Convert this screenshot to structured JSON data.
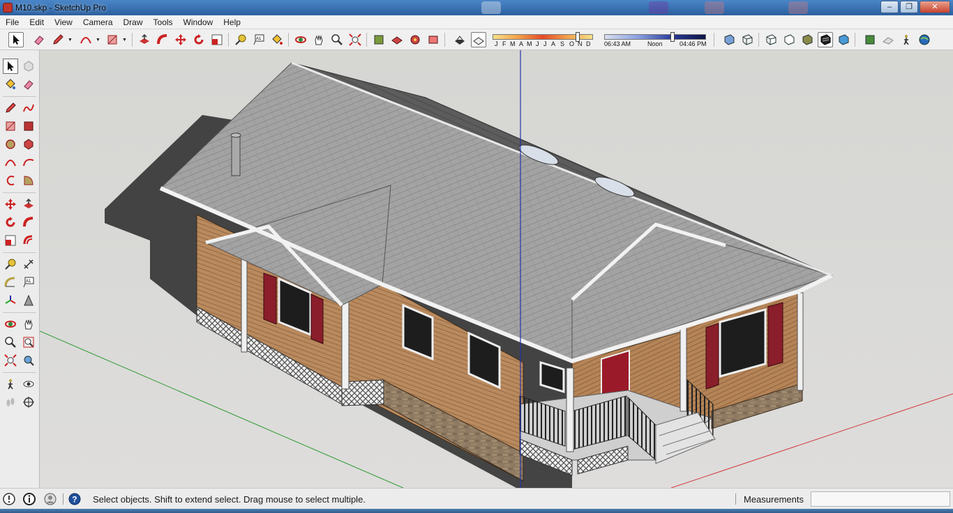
{
  "window": {
    "title": "M10.skp - SketchUp Pro",
    "controls": {
      "minimize": "–",
      "restore": "❐",
      "close": "✕"
    }
  },
  "menu": [
    "File",
    "Edit",
    "View",
    "Camera",
    "Draw",
    "Tools",
    "Window",
    "Help"
  ],
  "toolbar": {
    "tools": [
      "select-icon",
      "eraser-icon",
      "pencil-icon",
      "arc-icon",
      "rectangle-icon",
      "push-pull-icon",
      "follow-me-icon",
      "move-icon",
      "rotate-icon",
      "scale-icon",
      "tape-measure-icon",
      "text-icon",
      "paint-bucket-icon",
      "orbit-icon",
      "pan-icon",
      "zoom-icon",
      "zoom-extents-icon",
      "warehouse-icon",
      "share-model-icon",
      "components-icon",
      "extension-icon",
      "display-shadows-icon",
      "display-fog-icon",
      "xray-icon",
      "wireframe-icon",
      "hidden-line-icon",
      "shaded-icon",
      "shaded-textures-icon",
      "monochrome-icon",
      "geo-location-icon",
      "sandbox-icon",
      "walk-icon",
      "google-earth-icon"
    ],
    "shadow_months": [
      "J",
      "F",
      "M",
      "A",
      "M",
      "J",
      "J",
      "A",
      "S",
      "O",
      "N",
      "D"
    ],
    "shadow_times": {
      "start": "06:43 AM",
      "middle": "Noon",
      "end": "04:46 PM"
    }
  },
  "palette": {
    "tools": [
      "select-icon",
      "component-icon",
      "paint-bucket-icon",
      "eraser-icon",
      "line-icon",
      "freehand-icon",
      "rectangle-icon",
      "rotated-rectangle-icon",
      "circle-icon",
      "polygon-icon",
      "arc-icon",
      "two-point-arc-icon",
      "three-point-arc-icon",
      "pie-icon",
      "move-icon",
      "push-pull-icon",
      "rotate-icon",
      "follow-me-icon",
      "scale-icon",
      "offset-icon",
      "tape-measure-icon",
      "dimension-icon",
      "protractor-icon",
      "text-icon",
      "axes-icon",
      "3d-text-icon",
      "orbit-icon",
      "pan-icon",
      "zoom-icon",
      "zoom-window-icon",
      "zoom-extents-icon",
      "position-camera-icon",
      "walk-icon",
      "look-around-icon",
      "footprints-icon",
      "section-plane-icon"
    ]
  },
  "status": {
    "message": "Select objects. Shift to extend select. Drag mouse to select multiple.",
    "measurements_label": "Measurements",
    "measurements_value": ""
  },
  "colors": {
    "axis_red": "#d23a3a",
    "axis_green": "#2f9a2f",
    "axis_blue": "#2233aa",
    "roof": "#9c9c9c",
    "siding": "#b98a5e",
    "shutters": "#8a1e2a",
    "door": "#9a1a2a"
  }
}
